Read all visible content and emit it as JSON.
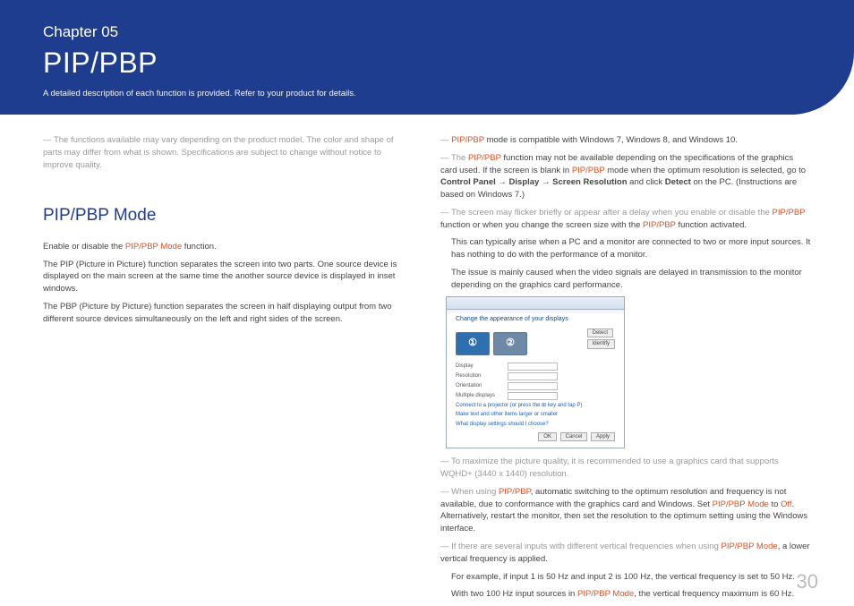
{
  "header": {
    "chapter": "Chapter  05",
    "title": "PIP/PBP",
    "subtitle": "A detailed description of each function is provided. Refer to your product for details."
  },
  "left": {
    "note1_pre": "―  The functions available may vary depending on the product model. The color and shape of parts may differ from what is shown. Specifications are subject to change without notice to improve quality.",
    "section_h": "PIP/PBP Mode",
    "p1a": "Enable or disable the ",
    "p1_hilite": "PIP/PBP Mode",
    "p1b": " function.",
    "p2": "The PIP (Picture in Picture) function separates the screen into two parts. One source device is displayed on the main screen at the same time the another source device is displayed in inset windows.",
    "p3": "The PBP (Picture by Picture) function separates the screen in half displaying output from two different source devices simultaneously on the left and right sides of the screen."
  },
  "right": {
    "n1a": "―  ",
    "n1_hl": "PIP/PBP",
    "n1b": " mode is compatible with Windows 7, Windows 8, and Windows 10.",
    "n2a": "―  The ",
    "n2_hl": "PIP/PBP",
    "n2b": " function may not be available depending on the specifications of the graphics card used. If the screen is blank in ",
    "n2_hl2": "PIP/PBP",
    "n2c": " mode when the optimum resolution is selected, go to ",
    "n2_b1": "Control Panel",
    "n2_arr": " → ",
    "n2_b2": "Display",
    "n2_b3": "Screen Resolution",
    "n2d": " and click ",
    "n2_b4": "Detect",
    "n2e": " on the PC. (Instructions are based on Windows 7.)",
    "n3a": "―  The screen may flicker briefly or appear after a delay when you enable or disable the ",
    "n3_hl": "PIP/PBP",
    "n3b": " function or when you change the screen size with the ",
    "n3_hl2": "PIP/PBP",
    "n3c": " function activated.",
    "n3d": "This can typically arise when a PC and a monitor are connected to two or more input sources. It has nothing to do with the performance of a monitor.",
    "n3e": "The issue is mainly caused when the video signals are delayed in transmission to the monitor depending on the graphics card performance.",
    "win_h": "Change the appearance of your displays",
    "win_rows": {
      "display": "Display",
      "resolution": "Resolution",
      "orientation": "Orientation",
      "multiple": "Multiple displays"
    },
    "win_detect": "Detect",
    "win_identify": "Identify",
    "win_link1": "Connect to a projector (or press the ⊞ key and tap P)",
    "win_link2": "Make text and other items larger or smaller",
    "win_link3": "What display settings should I choose?",
    "win_ok": "OK",
    "win_cancel": "Cancel",
    "win_apply": "Apply",
    "n4": "―  To maximize the picture quality, it is recommended to use a graphics card that supports WQHD+ (3440 x 1440) resolution.",
    "n5a": "―  When using ",
    "n5_hl": "PIP/PBP",
    "n5b": ", automatic switching to the optimum resolution and frequency is not available, due to conformance with the graphics card and Windows. Set ",
    "n5_hl2": "PIP/PBP Mode",
    "n5c": " to ",
    "n5_hl3": "Off",
    "n5d": ". Alternatively, restart the monitor, then set the resolution to the optimum setting using the Windows interface.",
    "n6a": "―  If there are several inputs with different vertical frequencies when using ",
    "n6_hl": "PIP/PBP Mode",
    "n6b": ", a lower vertical frequency is applied.",
    "n6c": "For example, if input 1 is 50 Hz and input 2 is 100 Hz, the vertical frequency is set to 50 Hz.",
    "n6d_a": "With two 100 Hz input sources in ",
    "n6d_hl": "PIP/PBP Mode",
    "n6d_b": ", the vertical frequency maximum is 60 Hz."
  },
  "page": "30"
}
